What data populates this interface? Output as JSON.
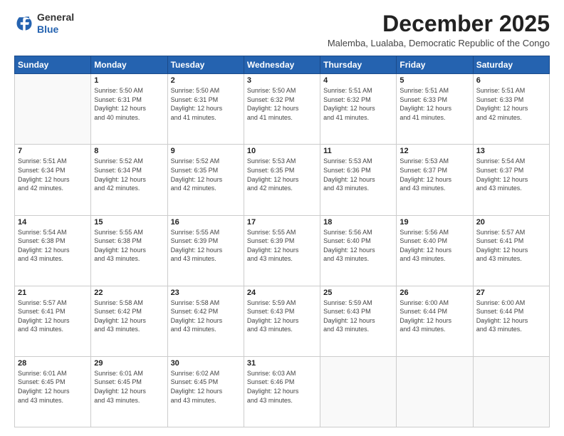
{
  "logo": {
    "general": "General",
    "blue": "Blue"
  },
  "header": {
    "month": "December 2025",
    "subtitle": "Malemba, Lualaba, Democratic Republic of the Congo"
  },
  "weekdays": [
    "Sunday",
    "Monday",
    "Tuesday",
    "Wednesday",
    "Thursday",
    "Friday",
    "Saturday"
  ],
  "weeks": [
    [
      {
        "day": "",
        "sunrise": "",
        "sunset": "",
        "daylight": ""
      },
      {
        "day": "1",
        "sunrise": "Sunrise: 5:50 AM",
        "sunset": "Sunset: 6:31 PM",
        "daylight": "Daylight: 12 hours and 40 minutes."
      },
      {
        "day": "2",
        "sunrise": "Sunrise: 5:50 AM",
        "sunset": "Sunset: 6:31 PM",
        "daylight": "Daylight: 12 hours and 41 minutes."
      },
      {
        "day": "3",
        "sunrise": "Sunrise: 5:50 AM",
        "sunset": "Sunset: 6:32 PM",
        "daylight": "Daylight: 12 hours and 41 minutes."
      },
      {
        "day": "4",
        "sunrise": "Sunrise: 5:51 AM",
        "sunset": "Sunset: 6:32 PM",
        "daylight": "Daylight: 12 hours and 41 minutes."
      },
      {
        "day": "5",
        "sunrise": "Sunrise: 5:51 AM",
        "sunset": "Sunset: 6:33 PM",
        "daylight": "Daylight: 12 hours and 41 minutes."
      },
      {
        "day": "6",
        "sunrise": "Sunrise: 5:51 AM",
        "sunset": "Sunset: 6:33 PM",
        "daylight": "Daylight: 12 hours and 42 minutes."
      }
    ],
    [
      {
        "day": "7",
        "sunrise": "Sunrise: 5:51 AM",
        "sunset": "Sunset: 6:34 PM",
        "daylight": "Daylight: 12 hours and 42 minutes."
      },
      {
        "day": "8",
        "sunrise": "Sunrise: 5:52 AM",
        "sunset": "Sunset: 6:34 PM",
        "daylight": "Daylight: 12 hours and 42 minutes."
      },
      {
        "day": "9",
        "sunrise": "Sunrise: 5:52 AM",
        "sunset": "Sunset: 6:35 PM",
        "daylight": "Daylight: 12 hours and 42 minutes."
      },
      {
        "day": "10",
        "sunrise": "Sunrise: 5:53 AM",
        "sunset": "Sunset: 6:35 PM",
        "daylight": "Daylight: 12 hours and 42 minutes."
      },
      {
        "day": "11",
        "sunrise": "Sunrise: 5:53 AM",
        "sunset": "Sunset: 6:36 PM",
        "daylight": "Daylight: 12 hours and 43 minutes."
      },
      {
        "day": "12",
        "sunrise": "Sunrise: 5:53 AM",
        "sunset": "Sunset: 6:37 PM",
        "daylight": "Daylight: 12 hours and 43 minutes."
      },
      {
        "day": "13",
        "sunrise": "Sunrise: 5:54 AM",
        "sunset": "Sunset: 6:37 PM",
        "daylight": "Daylight: 12 hours and 43 minutes."
      }
    ],
    [
      {
        "day": "14",
        "sunrise": "Sunrise: 5:54 AM",
        "sunset": "Sunset: 6:38 PM",
        "daylight": "Daylight: 12 hours and 43 minutes."
      },
      {
        "day": "15",
        "sunrise": "Sunrise: 5:55 AM",
        "sunset": "Sunset: 6:38 PM",
        "daylight": "Daylight: 12 hours and 43 minutes."
      },
      {
        "day": "16",
        "sunrise": "Sunrise: 5:55 AM",
        "sunset": "Sunset: 6:39 PM",
        "daylight": "Daylight: 12 hours and 43 minutes."
      },
      {
        "day": "17",
        "sunrise": "Sunrise: 5:55 AM",
        "sunset": "Sunset: 6:39 PM",
        "daylight": "Daylight: 12 hours and 43 minutes."
      },
      {
        "day": "18",
        "sunrise": "Sunrise: 5:56 AM",
        "sunset": "Sunset: 6:40 PM",
        "daylight": "Daylight: 12 hours and 43 minutes."
      },
      {
        "day": "19",
        "sunrise": "Sunrise: 5:56 AM",
        "sunset": "Sunset: 6:40 PM",
        "daylight": "Daylight: 12 hours and 43 minutes."
      },
      {
        "day": "20",
        "sunrise": "Sunrise: 5:57 AM",
        "sunset": "Sunset: 6:41 PM",
        "daylight": "Daylight: 12 hours and 43 minutes."
      }
    ],
    [
      {
        "day": "21",
        "sunrise": "Sunrise: 5:57 AM",
        "sunset": "Sunset: 6:41 PM",
        "daylight": "Daylight: 12 hours and 43 minutes."
      },
      {
        "day": "22",
        "sunrise": "Sunrise: 5:58 AM",
        "sunset": "Sunset: 6:42 PM",
        "daylight": "Daylight: 12 hours and 43 minutes."
      },
      {
        "day": "23",
        "sunrise": "Sunrise: 5:58 AM",
        "sunset": "Sunset: 6:42 PM",
        "daylight": "Daylight: 12 hours and 43 minutes."
      },
      {
        "day": "24",
        "sunrise": "Sunrise: 5:59 AM",
        "sunset": "Sunset: 6:43 PM",
        "daylight": "Daylight: 12 hours and 43 minutes."
      },
      {
        "day": "25",
        "sunrise": "Sunrise: 5:59 AM",
        "sunset": "Sunset: 6:43 PM",
        "daylight": "Daylight: 12 hours and 43 minutes."
      },
      {
        "day": "26",
        "sunrise": "Sunrise: 6:00 AM",
        "sunset": "Sunset: 6:44 PM",
        "daylight": "Daylight: 12 hours and 43 minutes."
      },
      {
        "day": "27",
        "sunrise": "Sunrise: 6:00 AM",
        "sunset": "Sunset: 6:44 PM",
        "daylight": "Daylight: 12 hours and 43 minutes."
      }
    ],
    [
      {
        "day": "28",
        "sunrise": "Sunrise: 6:01 AM",
        "sunset": "Sunset: 6:45 PM",
        "daylight": "Daylight: 12 hours and 43 minutes."
      },
      {
        "day": "29",
        "sunrise": "Sunrise: 6:01 AM",
        "sunset": "Sunset: 6:45 PM",
        "daylight": "Daylight: 12 hours and 43 minutes."
      },
      {
        "day": "30",
        "sunrise": "Sunrise: 6:02 AM",
        "sunset": "Sunset: 6:45 PM",
        "daylight": "Daylight: 12 hours and 43 minutes."
      },
      {
        "day": "31",
        "sunrise": "Sunrise: 6:03 AM",
        "sunset": "Sunset: 6:46 PM",
        "daylight": "Daylight: 12 hours and 43 minutes."
      },
      {
        "day": "",
        "sunrise": "",
        "sunset": "",
        "daylight": ""
      },
      {
        "day": "",
        "sunrise": "",
        "sunset": "",
        "daylight": ""
      },
      {
        "day": "",
        "sunrise": "",
        "sunset": "",
        "daylight": ""
      }
    ]
  ]
}
